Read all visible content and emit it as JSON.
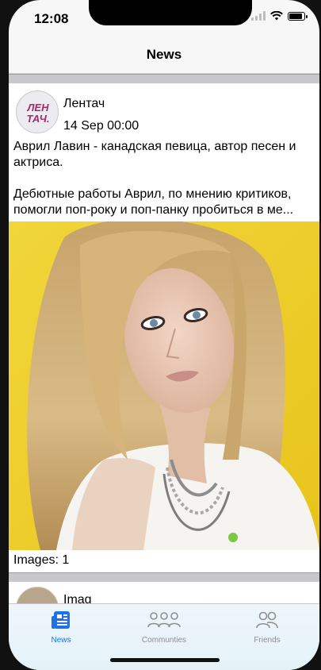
{
  "status_bar": {
    "time": "12:08"
  },
  "nav": {
    "title": "News"
  },
  "post": {
    "author": "Лентач",
    "date": "14 Sep 00:00",
    "avatar_text": "ЛЕН ТАЧ.",
    "text": "Аврил Лавин - канадская певица, автор песен и актриса.\n\nДебютные работы Аврил, по мнению критиков, помогли поп-року и поп-панку пробиться в ме...",
    "images_count": "Images: 1"
  },
  "post2": {
    "author": "Imag"
  },
  "tabs": [
    {
      "label": "News",
      "icon": "news-icon",
      "active": true
    },
    {
      "label": "Communties",
      "icon": "communities-icon",
      "active": false
    },
    {
      "label": "Friends",
      "icon": "friends-icon",
      "active": false
    }
  ],
  "colors": {
    "accent": "#1a73e8",
    "inactive": "#8e8e93",
    "photo_background": "#f2d430"
  }
}
